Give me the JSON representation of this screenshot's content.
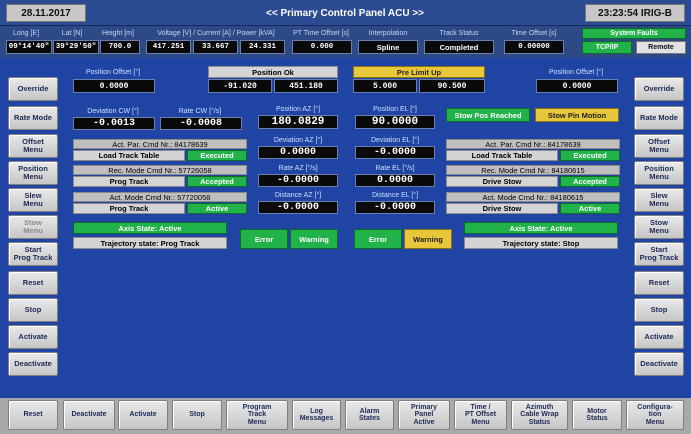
{
  "titlebar": {
    "date": "28.11.2017",
    "title": "<< Primary Control Panel ACU >>",
    "time": "23:23:54 IRIG-B"
  },
  "header": {
    "long_label": "Long [E]",
    "lat_label": "Lat [N]",
    "height_label": "Height [m]",
    "long_value": "09°14'40\"",
    "lat_value": "39°29'50\"",
    "height_value": "700.0",
    "power_label": "Voltage [V] / Current [A] / Power [kVA]",
    "voltage": "417.251",
    "current": "33.667",
    "power": "24.331",
    "pt_time_offset_label": "PT Time Offset [s]",
    "pt_time_offset": "0.000",
    "interpolation_label": "Interpolation",
    "interpolation": "Spline",
    "track_status_label": "Track Status",
    "track_status": "Completed",
    "time_offset_label": "Time Offset [s]",
    "time_offset": "0.00000",
    "system_faults": "System Faults",
    "tcpip": "TCP/IP",
    "remote": "Remote"
  },
  "left_buttons": [
    {
      "label": "Override"
    },
    {
      "label": "Rate Mode"
    },
    {
      "label": "Offset\nMenu"
    },
    {
      "label": "Position\nMenu"
    },
    {
      "label": "Slew\nMenu"
    },
    {
      "label": "Stow\nMenu"
    },
    {
      "label": "Start\nProg Track"
    },
    {
      "label": "Reset"
    },
    {
      "label": "Stop"
    },
    {
      "label": "Activate"
    },
    {
      "label": "Deactivate"
    }
  ],
  "right_buttons": [
    {
      "label": "Override"
    },
    {
      "label": "Rate Mode"
    },
    {
      "label": "Offset\nMenu"
    },
    {
      "label": "Position\nMenu"
    },
    {
      "label": "Slew\nMenu"
    },
    {
      "label": "Stow\nMenu"
    },
    {
      "label": "Start\nProg Track"
    },
    {
      "label": "Reset"
    },
    {
      "label": "Stop"
    },
    {
      "label": "Activate"
    },
    {
      "label": "Deactivate"
    }
  ],
  "bottom_buttons": [
    {
      "label": "Reset"
    },
    {
      "label": "Deactivate"
    },
    {
      "label": "Activate"
    },
    {
      "label": "Stop"
    },
    {
      "label": "Program\nTrack\nMenu"
    },
    {
      "label": "Log\nMessages"
    },
    {
      "label": "Alarm\nStates"
    },
    {
      "label": "Primary\nPanel\nActive"
    },
    {
      "label": "Time /\nPT Offset\nMenu"
    },
    {
      "label": "Azimuth\nCable Wrap\nStatus"
    },
    {
      "label": "Motor\nStatus"
    },
    {
      "label": "Configura-\ntion\nMenu"
    }
  ],
  "main": {
    "left_pos_offset_label": "Position Offset [°]",
    "left_pos_offset": "0.0000",
    "position_ok": "Position Ok",
    "pos_ok_az": "-91.020",
    "pos_ok_el": "451.180",
    "pre_limit_up": "Pre Limit Up",
    "pre_limit_az": "5.000",
    "pre_limit_el": "90.500",
    "right_pos_offset_label": "Position Offset [°]",
    "right_pos_offset": "0.0000",
    "dev_cw_label": "Deviation CW [°]",
    "dev_cw": "-0.0013",
    "rate_cw_label": "Rate  CW [°/s]",
    "rate_cw": "-0.0008",
    "pos_az_label": "Position AZ [°]",
    "pos_az": "180.0829",
    "pos_el_label": "Position EL [°]",
    "pos_el": "90.0000",
    "stow_pos_reached": "Stow Pos Reached",
    "stow_pin_motion": "Stow Pin Motion",
    "dev_az_label": "Deviation AZ [°]",
    "dev_az": "0.0000",
    "dev_el_label": "Deviation EL [°]",
    "dev_el": "-0.0000",
    "rate_az_label": "Rate AZ [°/s]",
    "rate_az": "-0.0000",
    "rate_el_label": "Rate EL [°/s]",
    "rate_el": "0.0000",
    "dist_az_label": "Distance AZ [°]",
    "dist_az": "-0.0000",
    "dist_el_label": "Distance EL [°]",
    "dist_el": "-0.0000",
    "l_act_par": "Act. Par. Cmd Nr.: 84178639",
    "l_load_track": "Load Track Table",
    "l_executed": "Executed",
    "l_rec_mode": "Rec. Mode Cmd Nr.: 57726058",
    "l_prog_track": "Prog Track",
    "l_accepted": "Accepted",
    "l_act_mode": "Act. Mode Cmd Nr.: 57720058",
    "l_prog_track2": "Prog Track",
    "l_active": "Active",
    "l_axis_state": "Axis State: Active",
    "l_traj_state": "Trajectory state: Prog Track",
    "r_act_par": "Act. Par. Cmd Nr.: 84178639",
    "r_load_track": "Load Track Table",
    "r_executed": "Executed",
    "r_rec_mode": "Rec. Mode Cmd Nr.: 84180615",
    "r_drive_stow": "Drive Stow",
    "r_accepted": "Accepted",
    "r_act_mode": "Act. Mode Cmd Nr.: 84180615",
    "r_drive_stow2": "Drive Stow",
    "r_active": "Active",
    "r_axis_state": "Axis State: Active",
    "r_traj_state": "Trajectory state: Stop",
    "az_error": "Error",
    "az_warning": "Warning",
    "el_error": "Error",
    "el_warning": "Warning"
  },
  "colors": {
    "panel_blue": "#1f44a3",
    "status_green": "#22b24a",
    "status_yellow": "#e8c83a",
    "title_bar_blue": "#2a4f9c"
  }
}
